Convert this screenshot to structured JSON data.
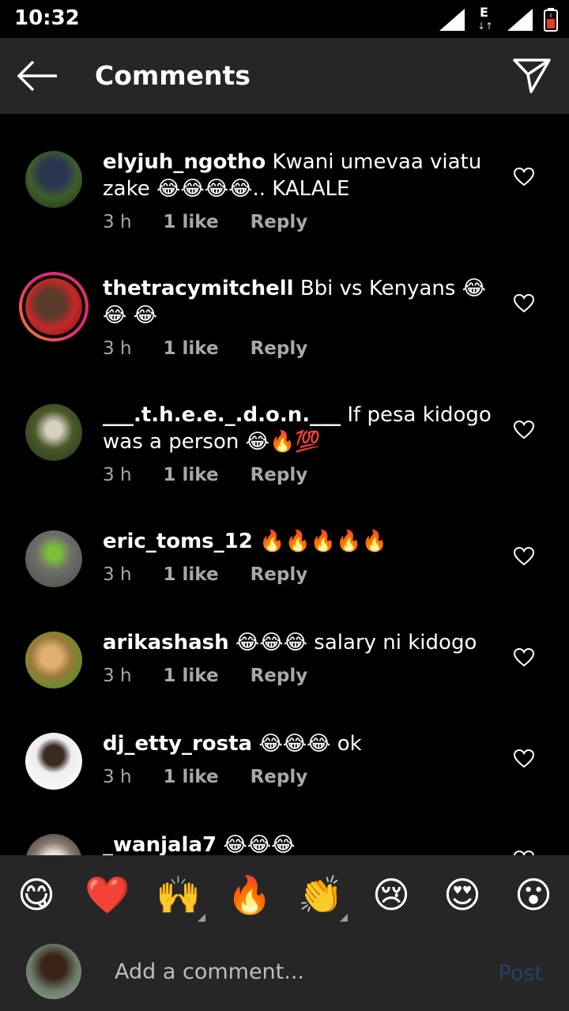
{
  "status": {
    "time": "10:32",
    "network_letter": "E"
  },
  "header": {
    "title": "Comments"
  },
  "comments": [
    {
      "user": "elyjuh_ngotho",
      "text": "Kwani umevaa viatu zake 😂😂😂😂.. KALALE",
      "time": "3 h",
      "likes": "1 like",
      "reply": "Reply"
    },
    {
      "user": "thetracymitchell",
      "text": "Bbi vs Kenyans 😂😂 😂",
      "time": "3 h",
      "likes": "1 like",
      "reply": "Reply"
    },
    {
      "user": "___.t.h.e.e._.d.o.n.___",
      "text": "If pesa kidogo was a person 😂🔥💯",
      "time": "3 h",
      "likes": "1 like",
      "reply": "Reply"
    },
    {
      "user": "eric_toms_12",
      "text": "🔥🔥🔥🔥🔥",
      "time": "3 h",
      "likes": "1 like",
      "reply": "Reply"
    },
    {
      "user": "arikashash",
      "text": "😂😂😂 salary  ni kidogo",
      "time": "3 h",
      "likes": "1 like",
      "reply": "Reply"
    },
    {
      "user": "dj_etty_rosta",
      "text": "😂😂😂 ok",
      "time": "3 h",
      "likes": "1 like",
      "reply": "Reply"
    },
    {
      "user": "_wanjala7",
      "text": "😂😂😂",
      "time": "",
      "likes": "",
      "reply": ""
    }
  ],
  "emoji_bar": [
    "😋",
    "❤️",
    "🙌",
    "🔥",
    "👏",
    "😢",
    "😍",
    "😮"
  ],
  "composer": {
    "placeholder": "Add a comment...",
    "post_label": "Post"
  },
  "colors": {
    "header_bg": "#262626",
    "post_disabled": "#27406b",
    "meta_text": "#a8a8a8"
  }
}
